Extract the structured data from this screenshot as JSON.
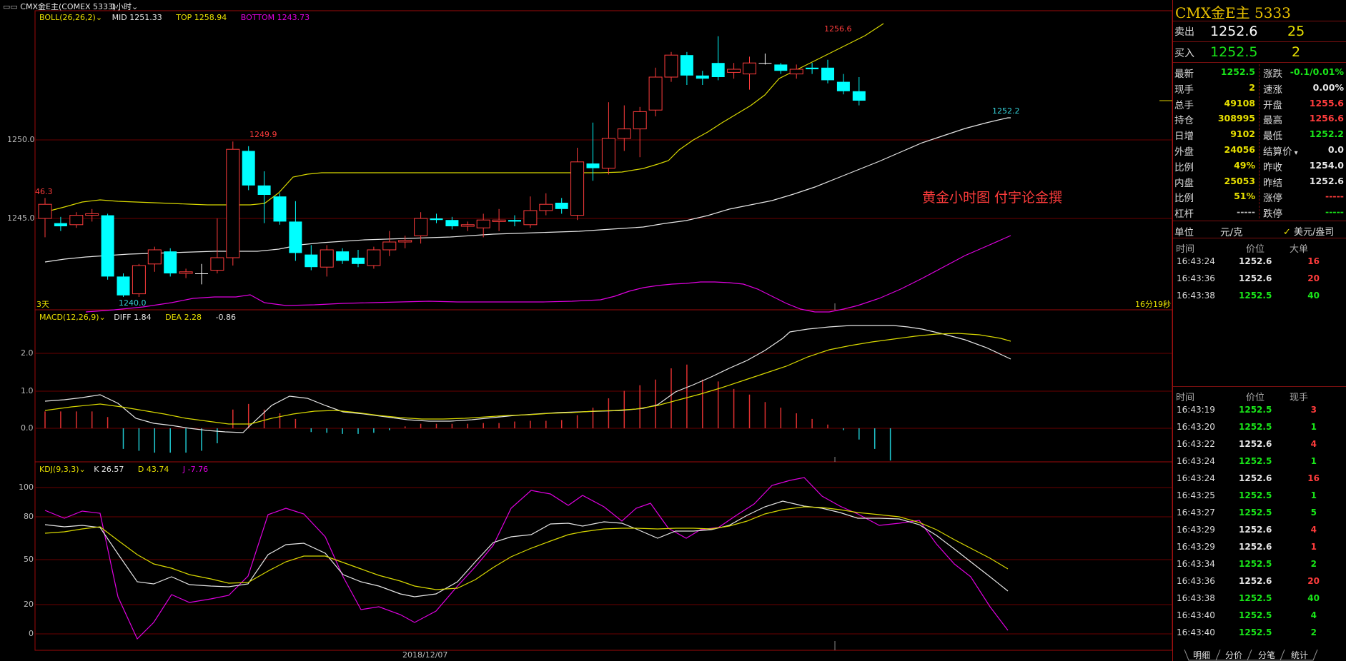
{
  "titlebar": {
    "symbol": "CMX金E主(COMEX 5333)",
    "period": "1小时"
  },
  "indicators": {
    "boll": {
      "name": "BOLL(26,26,2)",
      "mid": "MID 1251.33",
      "top": "TOP 1258.94",
      "bottom": "BOTTOM 1243.73"
    },
    "macd": {
      "name": "MACD(12,26,9)",
      "diff": "DIFF 1.84",
      "dea": "DEA 2.28",
      "macd": "-0.86"
    },
    "kdj": {
      "name": "KDJ(9,3,3)",
      "k": "K 26.57",
      "d": "D 43.74",
      "j": "J -7.76"
    }
  },
  "price_axis": {
    "labels": [
      "1250.0",
      "1245.0"
    ]
  },
  "macd_axis": {
    "labels": [
      "2.0",
      "1.0",
      "0.0"
    ]
  },
  "kdj_axis": {
    "labels": [
      "100",
      "80",
      "50",
      "20",
      "0"
    ]
  },
  "annotations": {
    "high_label": "1256.6",
    "peak_left": "1249.9",
    "left_top": "46.3",
    "low_label": "1240.0",
    "last_low": "1252.2",
    "days_label": "3天",
    "countdown": "16分19秒",
    "watermark": "黄金小时图  付宇论金撰",
    "date_axis": "2018/12/07"
  },
  "colors": {
    "up": "#ff3c3c",
    "down": "#00ffff",
    "mid": "#e6e6e6",
    "top": "#d8d800",
    "bottom": "#e000e0",
    "grid": "#8a0000"
  },
  "quote": {
    "title": "CMX金E主  5333",
    "sell_label": "卖出",
    "sell_price": "1252.6",
    "sell_qty": "25",
    "buy_label": "买入",
    "buy_price": "1252.5",
    "buy_qty": "2",
    "left_fields": [
      {
        "label": "最新",
        "value": "1252.5",
        "color": "green"
      },
      {
        "label": "现手",
        "value": "2",
        "color": "yellow"
      },
      {
        "label": "总手",
        "value": "49108",
        "color": "yellow"
      },
      {
        "label": "持仓",
        "value": "308995",
        "color": "yellow"
      },
      {
        "label": "日增",
        "value": "9102",
        "color": "yellow"
      },
      {
        "label": "外盘",
        "value": "24056",
        "color": "yellow"
      },
      {
        "label": "比例",
        "value": "49%",
        "color": "yellow"
      },
      {
        "label": "内盘",
        "value": "25053",
        "color": "yellow"
      },
      {
        "label": "比例",
        "value": "51%",
        "color": "yellow"
      },
      {
        "label": "杠杆",
        "value": "-----",
        "color": "gray"
      }
    ],
    "right_fields": [
      {
        "label": "涨跌",
        "value": "-0.1/0.01%",
        "color": "green"
      },
      {
        "label": "速涨",
        "value": "0.00%",
        "color": "white"
      },
      {
        "label": "开盘",
        "value": "1255.6",
        "color": "red"
      },
      {
        "label": "最高",
        "value": "1256.6",
        "color": "red"
      },
      {
        "label": "最低",
        "value": "1252.2",
        "color": "green"
      },
      {
        "label": "结算价",
        "value": "0.0",
        "color": "white"
      },
      {
        "label": "昨收",
        "value": "1254.0",
        "color": "white"
      },
      {
        "label": "昨结",
        "value": "1252.6",
        "color": "white"
      },
      {
        "label": "涨停",
        "value": "-----",
        "color": "red"
      },
      {
        "label": "跌停",
        "value": "-----",
        "color": "green"
      }
    ],
    "unit_label": "单位",
    "unit_value": "元/克",
    "unit_toggle": "美元/盎司"
  },
  "big_orders": {
    "headers": [
      "时间",
      "价位",
      "大单"
    ],
    "rows": [
      {
        "time": "16:43:24",
        "price": "1252.6",
        "qty": "16",
        "pc": "white",
        "qc": "red"
      },
      {
        "time": "16:43:36",
        "price": "1252.6",
        "qty": "20",
        "pc": "white",
        "qc": "red"
      },
      {
        "time": "16:43:38",
        "price": "1252.5",
        "qty": "40",
        "pc": "green",
        "qc": "green"
      }
    ]
  },
  "ticks": {
    "headers": [
      "时间",
      "价位",
      "现手"
    ],
    "rows": [
      {
        "time": "16:43:19",
        "price": "1252.5",
        "qty": "3",
        "pc": "green",
        "qc": "red"
      },
      {
        "time": "16:43:20",
        "price": "1252.5",
        "qty": "1",
        "pc": "green",
        "qc": "green"
      },
      {
        "time": "16:43:22",
        "price": "1252.6",
        "qty": "4",
        "pc": "white",
        "qc": "red"
      },
      {
        "time": "16:43:24",
        "price": "1252.5",
        "qty": "1",
        "pc": "green",
        "qc": "green"
      },
      {
        "time": "16:43:24",
        "price": "1252.6",
        "qty": "16",
        "pc": "white",
        "qc": "red"
      },
      {
        "time": "16:43:25",
        "price": "1252.5",
        "qty": "1",
        "pc": "green",
        "qc": "green"
      },
      {
        "time": "16:43:27",
        "price": "1252.5",
        "qty": "5",
        "pc": "green",
        "qc": "green"
      },
      {
        "time": "16:43:29",
        "price": "1252.6",
        "qty": "4",
        "pc": "white",
        "qc": "red"
      },
      {
        "time": "16:43:29",
        "price": "1252.6",
        "qty": "1",
        "pc": "white",
        "qc": "red"
      },
      {
        "time": "16:43:34",
        "price": "1252.5",
        "qty": "2",
        "pc": "green",
        "qc": "green"
      },
      {
        "time": "16:43:36",
        "price": "1252.6",
        "qty": "20",
        "pc": "white",
        "qc": "red"
      },
      {
        "time": "16:43:38",
        "price": "1252.5",
        "qty": "40",
        "pc": "green",
        "qc": "green"
      },
      {
        "time": "16:43:40",
        "price": "1252.5",
        "qty": "4",
        "pc": "green",
        "qc": "green"
      },
      {
        "time": "16:43:40",
        "price": "1252.5",
        "qty": "2",
        "pc": "green",
        "qc": "green"
      }
    ]
  },
  "tabs": [
    "明细",
    "分价",
    "分笔",
    "统计"
  ],
  "chart_data": {
    "type": "candlestick",
    "price_range": [
      1240.0,
      1258.0
    ],
    "candles": [
      [
        1245.0,
        1245.9,
        1243.8,
        1246.3
      ],
      [
        1244.7,
        1244.5,
        1244.2,
        1245.1
      ],
      [
        1244.6,
        1245.2,
        1244.4,
        1245.4
      ],
      [
        1245.2,
        1245.3,
        1244.8,
        1245.6
      ],
      [
        1245.2,
        1241.3,
        1241.1,
        1245.3
      ],
      [
        1241.3,
        1240.1,
        1240.0,
        1241.5
      ],
      [
        1240.2,
        1242.0,
        1240.0,
        1242.1
      ],
      [
        1242.1,
        1243.0,
        1241.6,
        1243.2
      ],
      [
        1242.9,
        1241.5,
        1241.3,
        1243.1
      ],
      [
        1241.5,
        1241.6,
        1241.2,
        1241.8
      ],
      [
        1241.5,
        1241.5,
        1240.8,
        1242.1
      ],
      [
        1241.7,
        1242.5,
        1241.5,
        1245.0
      ],
      [
        1242.5,
        1249.4,
        1242.0,
        1249.9
      ],
      [
        1249.3,
        1247.1,
        1246.8,
        1249.6
      ],
      [
        1247.1,
        1246.5,
        1244.7,
        1248.0
      ],
      [
        1246.4,
        1244.8,
        1244.6,
        1246.6
      ],
      [
        1244.8,
        1242.8,
        1242.3,
        1246.1
      ],
      [
        1242.7,
        1241.9,
        1241.7,
        1243.3
      ],
      [
        1241.9,
        1243.0,
        1241.3,
        1243.3
      ],
      [
        1242.9,
        1242.3,
        1242.1,
        1243.1
      ],
      [
        1242.5,
        1242.1,
        1241.9,
        1243.0
      ],
      [
        1242.0,
        1243.0,
        1241.8,
        1243.2
      ],
      [
        1243.0,
        1243.5,
        1242.6,
        1244.2
      ],
      [
        1243.5,
        1243.6,
        1243.1,
        1243.9
      ],
      [
        1243.9,
        1245.0,
        1243.4,
        1245.4
      ],
      [
        1245.0,
        1244.9,
        1244.7,
        1245.3
      ],
      [
        1244.9,
        1244.5,
        1244.3,
        1245.1
      ],
      [
        1244.5,
        1244.6,
        1244.2,
        1244.8
      ],
      [
        1244.4,
        1244.9,
        1243.8,
        1245.3
      ],
      [
        1244.8,
        1244.9,
        1244.2,
        1245.6
      ],
      [
        1244.9,
        1244.8,
        1244.5,
        1245.2
      ],
      [
        1244.6,
        1245.5,
        1244.4,
        1246.4
      ],
      [
        1245.5,
        1245.9,
        1245.2,
        1246.6
      ],
      [
        1246.0,
        1245.6,
        1245.3,
        1246.3
      ],
      [
        1245.2,
        1248.6,
        1244.9,
        1249.5
      ],
      [
        1248.5,
        1248.2,
        1247.4,
        1251.1
      ],
      [
        1248.2,
        1250.1,
        1247.8,
        1252.4
      ],
      [
        1250.1,
        1250.7,
        1249.3,
        1252.2
      ],
      [
        1250.7,
        1251.8,
        1248.9,
        1252.1
      ],
      [
        1251.9,
        1254.0,
        1251.5,
        1254.6
      ],
      [
        1254.0,
        1255.4,
        1253.7,
        1255.6
      ],
      [
        1255.4,
        1254.1,
        1253.5,
        1255.6
      ],
      [
        1254.1,
        1253.9,
        1253.5,
        1254.4
      ],
      [
        1254.9,
        1254.0,
        1253.8,
        1256.6
      ],
      [
        1254.3,
        1254.5,
        1253.9,
        1254.9
      ],
      [
        1254.2,
        1254.9,
        1253.2,
        1255.3
      ],
      [
        1254.9,
        1254.9,
        1254.8,
        1255.5
      ],
      [
        1254.8,
        1254.4,
        1254.2,
        1254.9
      ],
      [
        1254.2,
        1254.5,
        1253.9,
        1254.8
      ],
      [
        1254.6,
        1254.5,
        1254.2,
        1254.9
      ],
      [
        1254.6,
        1253.8,
        1253.6,
        1255.1
      ],
      [
        1253.7,
        1253.1,
        1252.9,
        1254.2
      ],
      [
        1253.1,
        1252.5,
        1252.2,
        1254.0
      ]
    ]
  }
}
